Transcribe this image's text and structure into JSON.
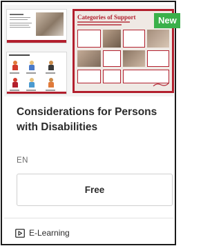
{
  "card": {
    "badge": "New",
    "title": "Considerations for Persons with Disabilities",
    "language": "EN",
    "price_label": "Free",
    "type_label": "E-Learning",
    "type_icon": "e-learning-icon"
  },
  "thumbnail": {
    "right_slide_title": "Categories of Support"
  },
  "colors": {
    "accent": "#b21f2d",
    "badge": "#3ab04a",
    "border": "#1a1a1a"
  }
}
